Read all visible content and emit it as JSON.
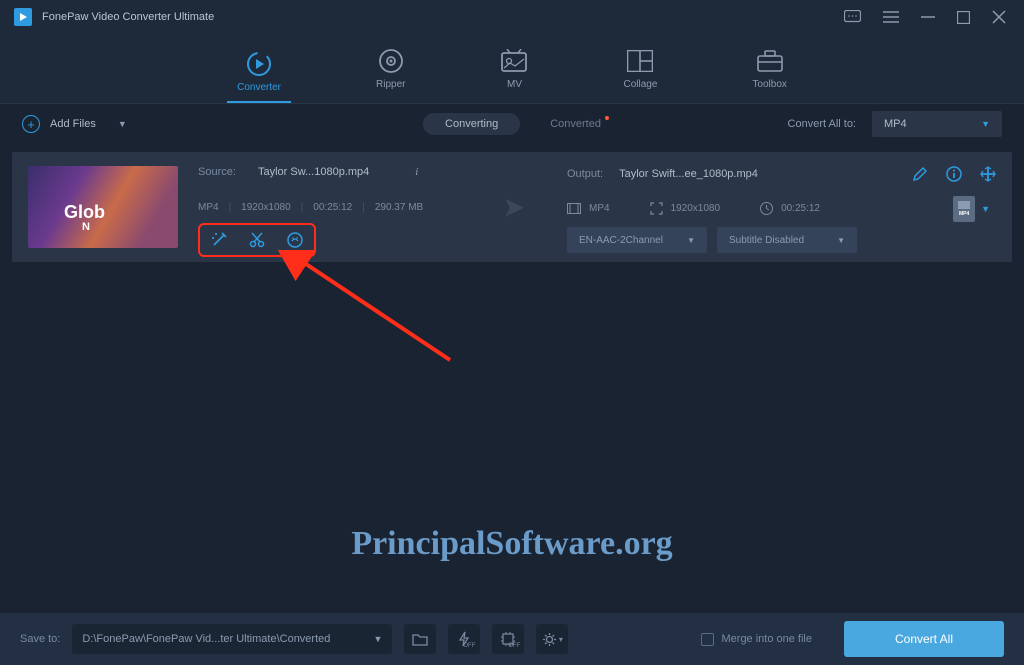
{
  "app": {
    "title": "FonePaw Video Converter Ultimate"
  },
  "tabs": [
    {
      "label": "Converter",
      "active": true
    },
    {
      "label": "Ripper"
    },
    {
      "label": "MV"
    },
    {
      "label": "Collage"
    },
    {
      "label": "Toolbox"
    }
  ],
  "secondbar": {
    "add_files": "Add Files",
    "converting": "Converting",
    "converted": "Converted",
    "convert_all_to": "Convert All to:",
    "format": "MP4"
  },
  "item": {
    "thumb_text": "Glob",
    "thumb_sub": "N",
    "source_label": "Source:",
    "source_value": "Taylor Sw...1080p.mp4",
    "meta": {
      "codec": "MP4",
      "res": "1920x1080",
      "dur": "00:25:12",
      "size": "290.37 MB"
    },
    "output_label": "Output:",
    "output_value": "Taylor Swift...ee_1080p.mp4",
    "out_meta": {
      "codec": "MP4",
      "res": "1920x1080",
      "dur": "00:25:12"
    },
    "audio_select": "EN-AAC-2Channel",
    "subtitle_select": "Subtitle Disabled",
    "badge": "MP4"
  },
  "watermark": "PrincipalSoftware.org",
  "footer": {
    "save_to_label": "Save to:",
    "path": "D:\\FonePaw\\FonePaw Vid...ter Ultimate\\Converted",
    "merge": "Merge into one file",
    "convert_all": "Convert All"
  }
}
